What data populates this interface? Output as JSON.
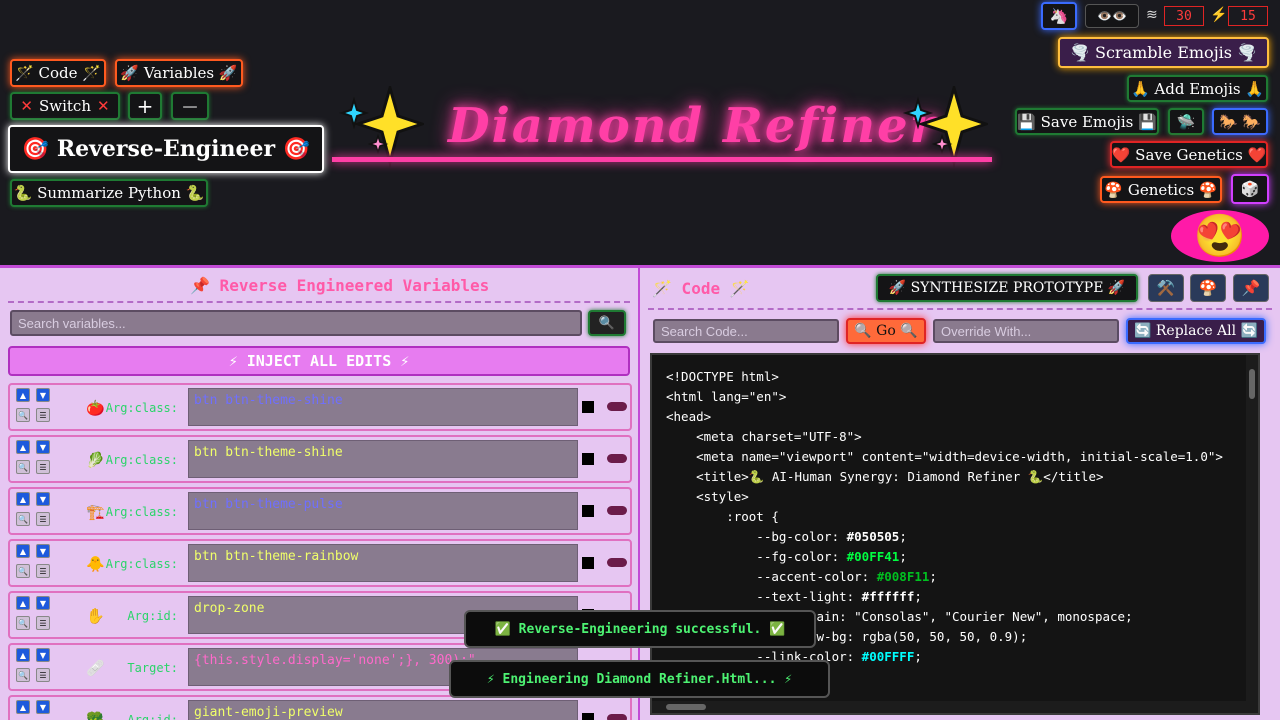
{
  "header": {
    "title": "Diamond Refiner",
    "sparkle_icon": "sparkles",
    "top_status": {
      "unicorn_icon": "🦄",
      "eyes_icon": "👁️👁️",
      "wave_label": "≋",
      "wave_value": "30",
      "bolt_label": "⚡",
      "bolt_value": "15"
    }
  },
  "left_controls": {
    "code_label": "🪄 Code 🪄",
    "variables_label": "🚀 Variables 🚀",
    "switch_label": "Switch",
    "plus_label": "+",
    "minus_label": "—",
    "reverse_label": "🎯 Reverse-Engineer 🎯",
    "summarize_label": "🐍 Summarize Python 🐍"
  },
  "right_controls": {
    "scramble_label": "🌪️ Scramble Emojis 🌪️",
    "add_label": "🙏 Add Emojis 🙏",
    "save_emojis_label": "💾 Save Emojis 💾",
    "ufo_label": "🛸",
    "horses_label": "🐎 🐎",
    "save_genetics_label": "❤️ Save Genetics ❤️",
    "genetics_label": "🍄 Genetics 🍄",
    "dice_label": "🎲",
    "face_label": "😍"
  },
  "left_panel": {
    "title": "📌 Reverse Engineered Variables",
    "search_placeholder": "Search variables...",
    "search_icon": "🔍",
    "inject_label": "⚡ INJECT ALL EDITS ⚡",
    "rows": [
      {
        "emoji": "🍅",
        "label": "Arg:class:",
        "value": "btn btn-theme-shine",
        "color": "#6f6fff"
      },
      {
        "emoji": "🥬",
        "label": "Arg:class:",
        "value": "btn btn-theme-shine",
        "color": "#f0ff6a"
      },
      {
        "emoji": "🏗️",
        "label": "Arg:class:",
        "value": "btn btn-theme-pulse",
        "color": "#6f6fff"
      },
      {
        "emoji": "🐥",
        "label": "Arg:class:",
        "value": "btn btn-theme-rainbow",
        "color": "#f0ff6a"
      },
      {
        "emoji": "✋",
        "label": "Arg:id:",
        "value": "drop-zone",
        "color": "#f0ff6a"
      },
      {
        "emoji": "🩹",
        "label": "Target:",
        "value": "{this.style.display='none';}, 300);\"",
        "color": "#ff6acb"
      },
      {
        "emoji": "🥦",
        "label": "Arg:id:",
        "value": "giant-emoji-preview",
        "color": "#f0ff6a"
      }
    ]
  },
  "right_panel": {
    "title": "🪄 Code 🪄",
    "synth_label": "🚀 SYNTHESIZE PROTOTYPE 🚀",
    "tools_icon": "⚒️",
    "mushroom_icon": "🍄",
    "pin_icon": "📌",
    "search_placeholder": "Search Code...",
    "go_label": "🔍 Go 🔍",
    "override_placeholder": "Override With...",
    "replace_label": "🔄 Replace All 🔄",
    "code_lines": [
      "<!DOCTYPE html>",
      "<html lang=\"en\">",
      "<head>",
      "    <meta charset=\"UTF-8\">",
      "    <meta name=\"viewport\" content=\"width=device-width, initial-scale=1.0\">",
      "    <title>🐍 AI-Human Synergy: Diamond Refiner 🐍</title>",
      "    <style>",
      "        :root {",
      "            --bg-color: #050505;",
      "            --fg-color: #00FF41;",
      "            --accent-color: #008F11;",
      "            --text-light: #ffffff;",
      "            --font-main: \"Consolas\", \"Courier New\", monospace;",
      "            --preview-bg: rgba(50, 50, 50, 0.9);",
      "            --link-color: #00FFFF;"
    ],
    "hex_colors": [
      "#050505",
      "#00FF41",
      "#008F11",
      "#ffffff",
      "#00FFFF"
    ]
  },
  "toasts": {
    "success": "✅ Reverse-Engineering successful. ✅",
    "progress": "⚡ Engineering Diamond Refiner.Html... ⚡"
  }
}
